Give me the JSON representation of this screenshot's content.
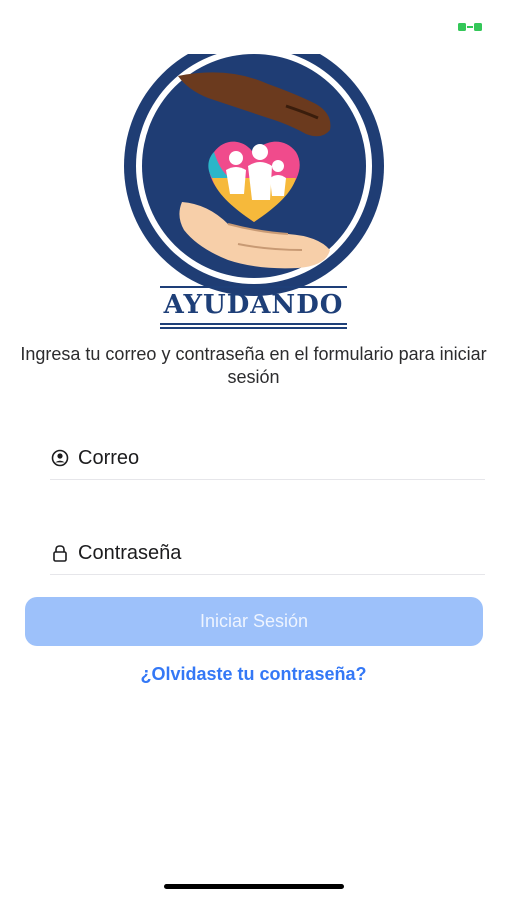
{
  "status_bar": {
    "indicator_icon": "battery-indicator",
    "indicator_color": "#34c759"
  },
  "logo": {
    "brand_name": "AYUDANDO",
    "icon": "helping-hands-heart-logo"
  },
  "instructions": "Ingresa tu correo y contraseña en el formulario para iniciar sesión",
  "form": {
    "email": {
      "placeholder": "Correo",
      "value": "",
      "icon": "user-circle-icon"
    },
    "password": {
      "placeholder": "Contraseña",
      "value": "",
      "icon": "lock-icon"
    },
    "submit_label": "Iniciar Sesión",
    "submit_color": "#9dc1fa"
  },
  "forgot_password_label": "¿Olvidaste tu contraseña?",
  "colors": {
    "brand": "#1e3f78",
    "link": "#3478f6"
  }
}
